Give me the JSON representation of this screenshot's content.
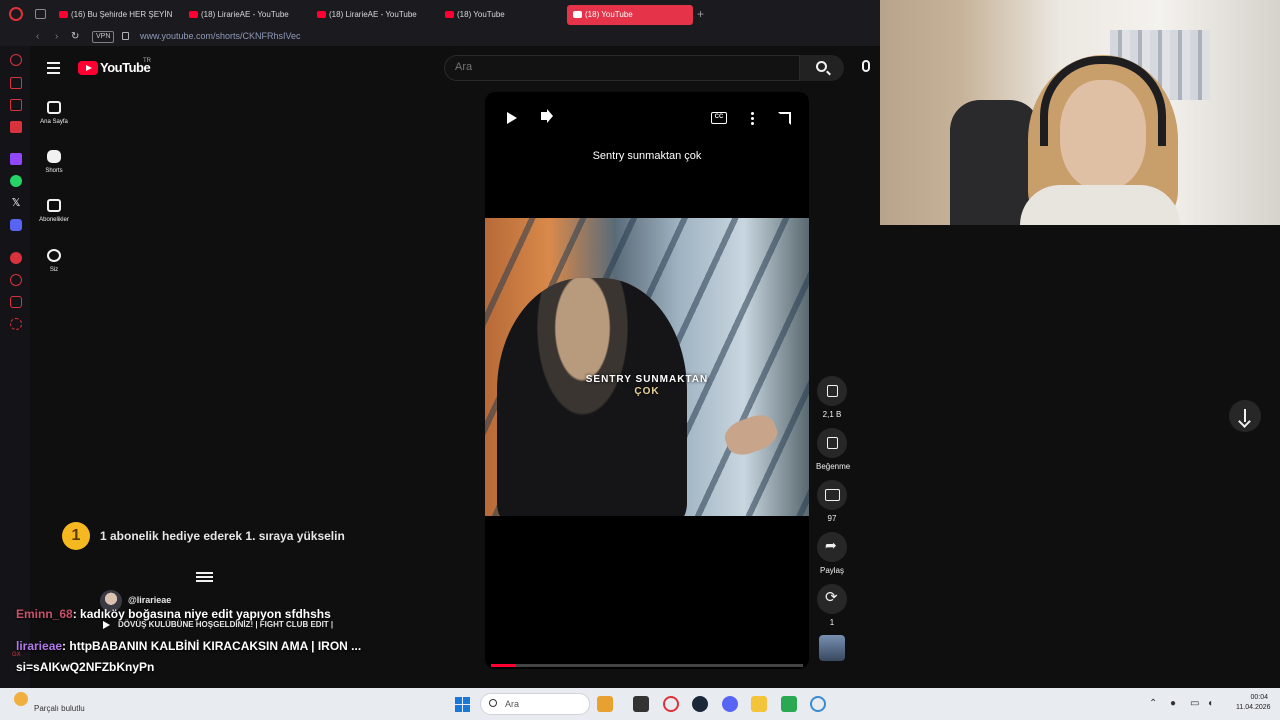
{
  "browser": {
    "tabs": [
      {
        "label": "(16) Bu Şehirde HER ŞEYİN"
      },
      {
        "label": "(18) LirarieAE - YouTube"
      },
      {
        "label": "(18) LirarieAE - YouTube"
      },
      {
        "label": "(18) YouTube"
      },
      {
        "label": "(18) YouTube"
      }
    ],
    "new_tab": "+",
    "vpn_label": "VPN",
    "url": "www.youtube.com/shorts/CKNFRhsIVec"
  },
  "youtube": {
    "logo_text": "YouTube",
    "country_code": "TR",
    "search_placeholder": "Ara",
    "nav": [
      {
        "label": "Ana Sayfa"
      },
      {
        "label": "Shorts"
      },
      {
        "label": "Abonelikler"
      },
      {
        "label": "Siz"
      }
    ],
    "short": {
      "title": "Sentry sunmaktan çok",
      "caption_line1": "SENTRY SUNMAKTAN",
      "caption_line2": "ÇOK",
      "cc_label": "CC",
      "progress": 0.08
    },
    "actions": {
      "likes": "2,1 B",
      "dislike_label": "Beğenme",
      "comments": "97",
      "share_label": "Paylaş",
      "remix_count": "1"
    }
  },
  "overlay": {
    "rank_number": "1",
    "rank_text": "1 abonelik hediye ederek 1. sıraya yükselin",
    "now_playing_user": "@lirarieae",
    "now_playing_title": "DÖVÜŞ KULÜBÜNE HOŞGELDİNİZ! | FIGHT CLUB EDIT |",
    "chat": [
      {
        "user": "Eminn_68",
        "message": "kadıköy boğasına niye edit yapıyon sfdhshs"
      },
      {
        "user": "lirarieae",
        "message": "httpBABANIN KALBİNİ KIRACAKSIN AMA | IRON ..."
      },
      {
        "user": "",
        "message": "si=sAIKwQ2NFZbKnyPn"
      },
      {
        "user": "lirarieae",
        "message": ""
      }
    ],
    "gx_label": "GX"
  },
  "taskbar": {
    "weather_label": "Parçalı bulutlu",
    "search_placeholder": "Ara",
    "time": "00:04",
    "date": "11.04.2026"
  }
}
